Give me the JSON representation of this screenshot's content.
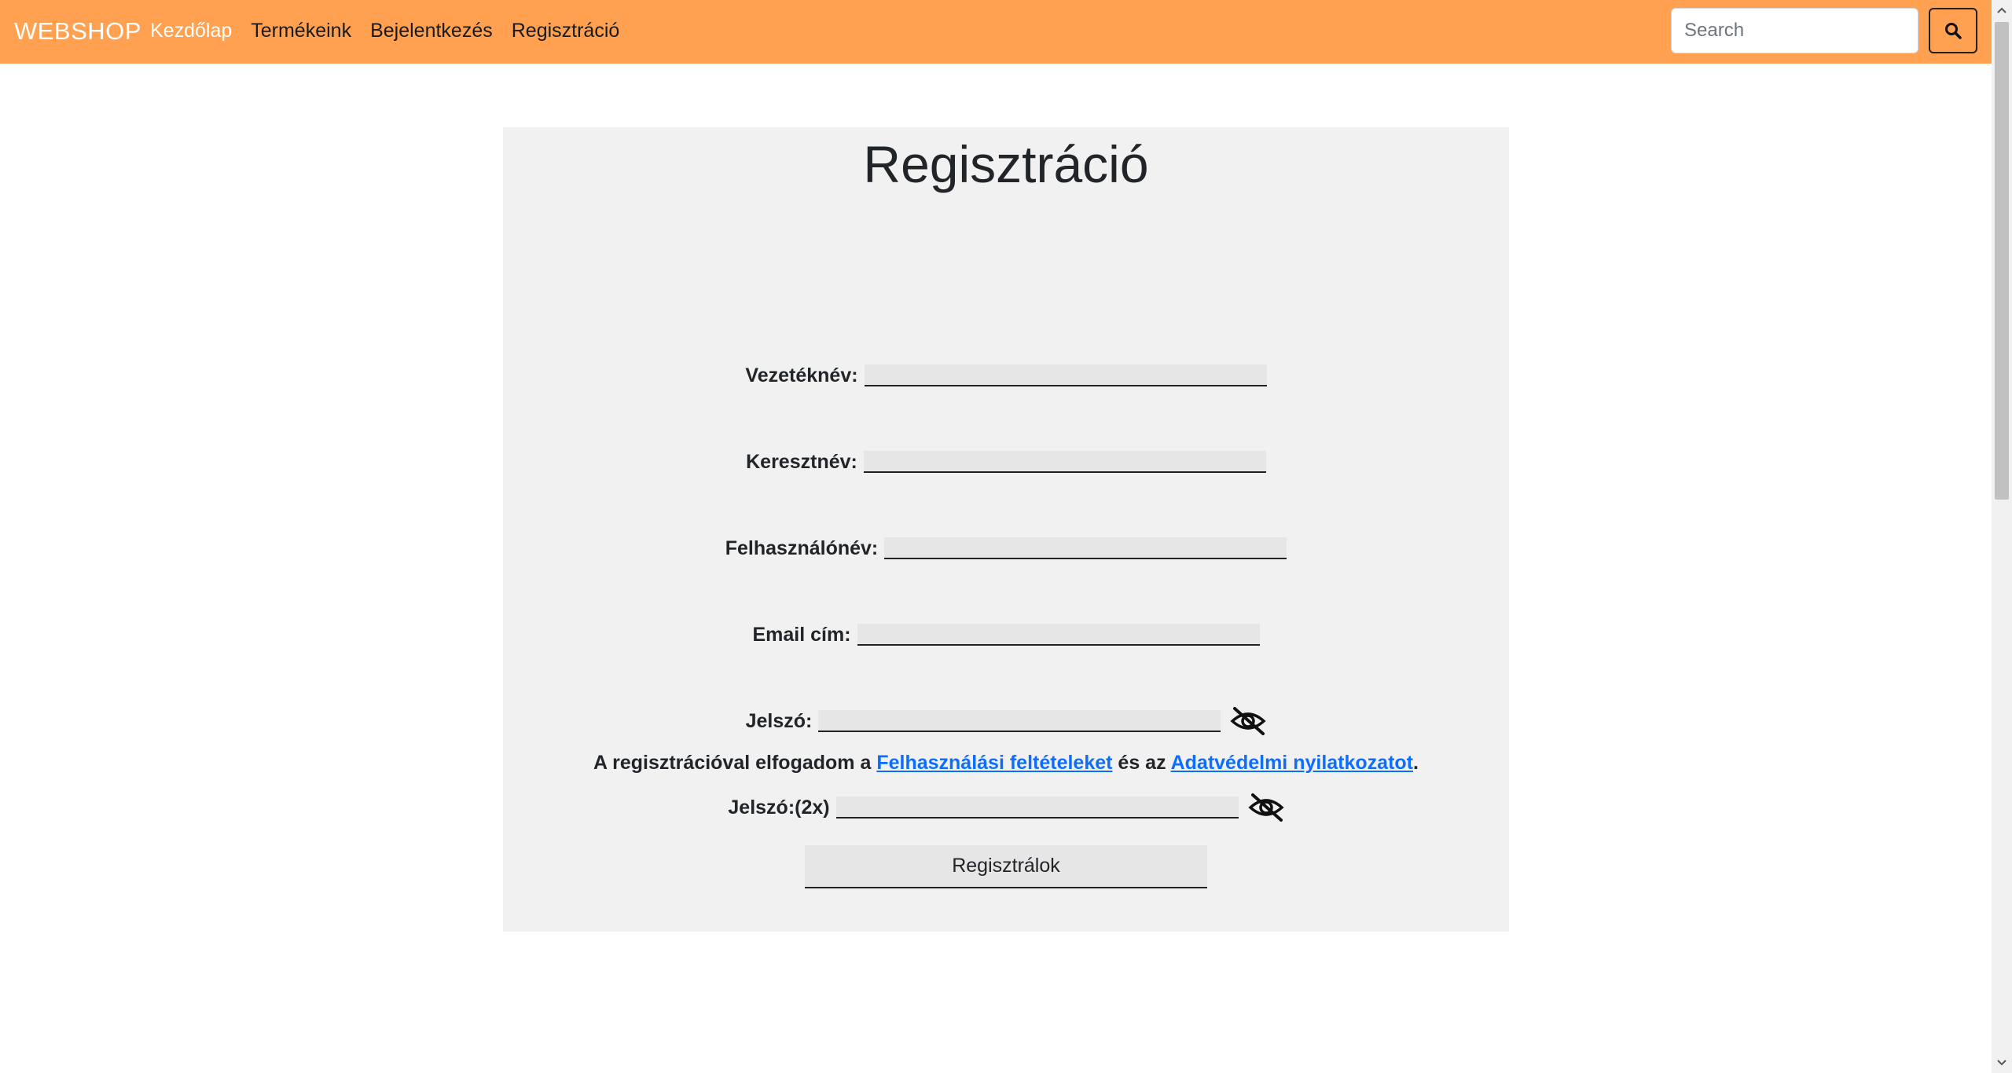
{
  "nav": {
    "brand": "WEBSHOP",
    "links": [
      {
        "label": "Kezdőlap",
        "active": true
      },
      {
        "label": "Termékeink",
        "active": false
      },
      {
        "label": "Bejelentkezés",
        "active": false
      },
      {
        "label": "Regisztráció",
        "active": false
      }
    ],
    "search_placeholder": "Search",
    "search_icon": "search-icon",
    "background": "#ffa150"
  },
  "form": {
    "title": "Regisztráció",
    "fields": [
      {
        "label": "Vezetéknév:",
        "value": ""
      },
      {
        "label": "Keresztnév:",
        "value": ""
      },
      {
        "label": "Felhasználónév:",
        "value": ""
      },
      {
        "label": "Email cím:",
        "value": ""
      },
      {
        "label": "Jelszó:",
        "value": "",
        "toggle_icon": "eye-slash-icon"
      },
      {
        "label": "Jelszó:(2x)",
        "value": "",
        "toggle_icon": "eye-slash-icon"
      }
    ],
    "terms": {
      "prefix": "A regisztrációval elfogadom a ",
      "link1": "Felhasználási feltételeket",
      "middle": " és az ",
      "link2": "Adatvédelmi nyilatkozatot",
      "suffix": "."
    },
    "submit_label": "Regisztrálok",
    "link_color": "#0d6efd"
  }
}
